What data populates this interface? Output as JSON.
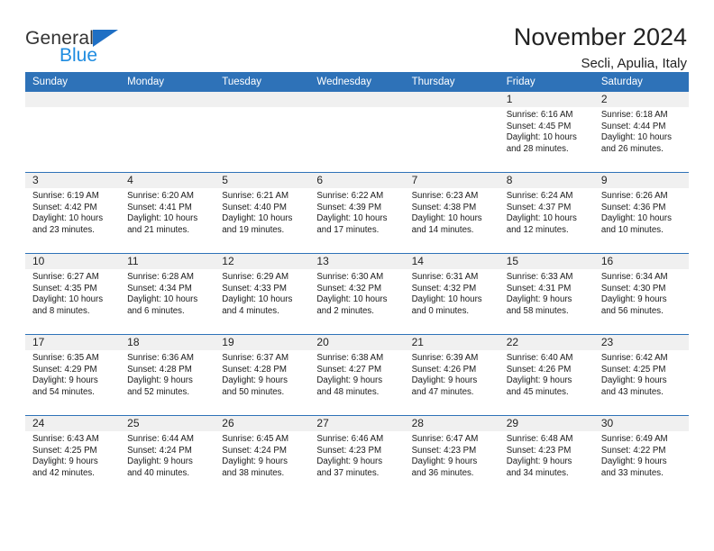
{
  "brand": {
    "name_line1": "General",
    "name_line2": "Blue",
    "triangle_color": "#1f6fc4",
    "blue_color": "#1f8ce0"
  },
  "header": {
    "title": "November 2024",
    "subtitle": "Secli, Apulia, Italy"
  },
  "theme": {
    "header_blue": "#2e72b8",
    "daynum_gray": "#f0f0f0"
  },
  "weekdays": [
    "Sunday",
    "Monday",
    "Tuesday",
    "Wednesday",
    "Thursday",
    "Friday",
    "Saturday"
  ],
  "labels": {
    "sunrise_prefix": "Sunrise:",
    "sunset_prefix": "Sunset:",
    "daylight_prefix": "Daylight:"
  },
  "weeks": [
    [
      {
        "day": "",
        "empty": true
      },
      {
        "day": "",
        "empty": true
      },
      {
        "day": "",
        "empty": true
      },
      {
        "day": "",
        "empty": true
      },
      {
        "day": "",
        "empty": true
      },
      {
        "day": "1",
        "sunrise": "Sunrise: 6:16 AM",
        "sunset": "Sunset: 4:45 PM",
        "daylight_line1": "Daylight: 10 hours",
        "daylight_line2": "and 28 minutes."
      },
      {
        "day": "2",
        "sunrise": "Sunrise: 6:18 AM",
        "sunset": "Sunset: 4:44 PM",
        "daylight_line1": "Daylight: 10 hours",
        "daylight_line2": "and 26 minutes."
      }
    ],
    [
      {
        "day": "3",
        "sunrise": "Sunrise: 6:19 AM",
        "sunset": "Sunset: 4:42 PM",
        "daylight_line1": "Daylight: 10 hours",
        "daylight_line2": "and 23 minutes."
      },
      {
        "day": "4",
        "sunrise": "Sunrise: 6:20 AM",
        "sunset": "Sunset: 4:41 PM",
        "daylight_line1": "Daylight: 10 hours",
        "daylight_line2": "and 21 minutes."
      },
      {
        "day": "5",
        "sunrise": "Sunrise: 6:21 AM",
        "sunset": "Sunset: 4:40 PM",
        "daylight_line1": "Daylight: 10 hours",
        "daylight_line2": "and 19 minutes."
      },
      {
        "day": "6",
        "sunrise": "Sunrise: 6:22 AM",
        "sunset": "Sunset: 4:39 PM",
        "daylight_line1": "Daylight: 10 hours",
        "daylight_line2": "and 17 minutes."
      },
      {
        "day": "7",
        "sunrise": "Sunrise: 6:23 AM",
        "sunset": "Sunset: 4:38 PM",
        "daylight_line1": "Daylight: 10 hours",
        "daylight_line2": "and 14 minutes."
      },
      {
        "day": "8",
        "sunrise": "Sunrise: 6:24 AM",
        "sunset": "Sunset: 4:37 PM",
        "daylight_line1": "Daylight: 10 hours",
        "daylight_line2": "and 12 minutes."
      },
      {
        "day": "9",
        "sunrise": "Sunrise: 6:26 AM",
        "sunset": "Sunset: 4:36 PM",
        "daylight_line1": "Daylight: 10 hours",
        "daylight_line2": "and 10 minutes."
      }
    ],
    [
      {
        "day": "10",
        "sunrise": "Sunrise: 6:27 AM",
        "sunset": "Sunset: 4:35 PM",
        "daylight_line1": "Daylight: 10 hours",
        "daylight_line2": "and 8 minutes."
      },
      {
        "day": "11",
        "sunrise": "Sunrise: 6:28 AM",
        "sunset": "Sunset: 4:34 PM",
        "daylight_line1": "Daylight: 10 hours",
        "daylight_line2": "and 6 minutes."
      },
      {
        "day": "12",
        "sunrise": "Sunrise: 6:29 AM",
        "sunset": "Sunset: 4:33 PM",
        "daylight_line1": "Daylight: 10 hours",
        "daylight_line2": "and 4 minutes."
      },
      {
        "day": "13",
        "sunrise": "Sunrise: 6:30 AM",
        "sunset": "Sunset: 4:32 PM",
        "daylight_line1": "Daylight: 10 hours",
        "daylight_line2": "and 2 minutes."
      },
      {
        "day": "14",
        "sunrise": "Sunrise: 6:31 AM",
        "sunset": "Sunset: 4:32 PM",
        "daylight_line1": "Daylight: 10 hours",
        "daylight_line2": "and 0 minutes."
      },
      {
        "day": "15",
        "sunrise": "Sunrise: 6:33 AM",
        "sunset": "Sunset: 4:31 PM",
        "daylight_line1": "Daylight: 9 hours",
        "daylight_line2": "and 58 minutes."
      },
      {
        "day": "16",
        "sunrise": "Sunrise: 6:34 AM",
        "sunset": "Sunset: 4:30 PM",
        "daylight_line1": "Daylight: 9 hours",
        "daylight_line2": "and 56 minutes."
      }
    ],
    [
      {
        "day": "17",
        "sunrise": "Sunrise: 6:35 AM",
        "sunset": "Sunset: 4:29 PM",
        "daylight_line1": "Daylight: 9 hours",
        "daylight_line2": "and 54 minutes."
      },
      {
        "day": "18",
        "sunrise": "Sunrise: 6:36 AM",
        "sunset": "Sunset: 4:28 PM",
        "daylight_line1": "Daylight: 9 hours",
        "daylight_line2": "and 52 minutes."
      },
      {
        "day": "19",
        "sunrise": "Sunrise: 6:37 AM",
        "sunset": "Sunset: 4:28 PM",
        "daylight_line1": "Daylight: 9 hours",
        "daylight_line2": "and 50 minutes."
      },
      {
        "day": "20",
        "sunrise": "Sunrise: 6:38 AM",
        "sunset": "Sunset: 4:27 PM",
        "daylight_line1": "Daylight: 9 hours",
        "daylight_line2": "and 48 minutes."
      },
      {
        "day": "21",
        "sunrise": "Sunrise: 6:39 AM",
        "sunset": "Sunset: 4:26 PM",
        "daylight_line1": "Daylight: 9 hours",
        "daylight_line2": "and 47 minutes."
      },
      {
        "day": "22",
        "sunrise": "Sunrise: 6:40 AM",
        "sunset": "Sunset: 4:26 PM",
        "daylight_line1": "Daylight: 9 hours",
        "daylight_line2": "and 45 minutes."
      },
      {
        "day": "23",
        "sunrise": "Sunrise: 6:42 AM",
        "sunset": "Sunset: 4:25 PM",
        "daylight_line1": "Daylight: 9 hours",
        "daylight_line2": "and 43 minutes."
      }
    ],
    [
      {
        "day": "24",
        "sunrise": "Sunrise: 6:43 AM",
        "sunset": "Sunset: 4:25 PM",
        "daylight_line1": "Daylight: 9 hours",
        "daylight_line2": "and 42 minutes."
      },
      {
        "day": "25",
        "sunrise": "Sunrise: 6:44 AM",
        "sunset": "Sunset: 4:24 PM",
        "daylight_line1": "Daylight: 9 hours",
        "daylight_line2": "and 40 minutes."
      },
      {
        "day": "26",
        "sunrise": "Sunrise: 6:45 AM",
        "sunset": "Sunset: 4:24 PM",
        "daylight_line1": "Daylight: 9 hours",
        "daylight_line2": "and 38 minutes."
      },
      {
        "day": "27",
        "sunrise": "Sunrise: 6:46 AM",
        "sunset": "Sunset: 4:23 PM",
        "daylight_line1": "Daylight: 9 hours",
        "daylight_line2": "and 37 minutes."
      },
      {
        "day": "28",
        "sunrise": "Sunrise: 6:47 AM",
        "sunset": "Sunset: 4:23 PM",
        "daylight_line1": "Daylight: 9 hours",
        "daylight_line2": "and 36 minutes."
      },
      {
        "day": "29",
        "sunrise": "Sunrise: 6:48 AM",
        "sunset": "Sunset: 4:23 PM",
        "daylight_line1": "Daylight: 9 hours",
        "daylight_line2": "and 34 minutes."
      },
      {
        "day": "30",
        "sunrise": "Sunrise: 6:49 AM",
        "sunset": "Sunset: 4:22 PM",
        "daylight_line1": "Daylight: 9 hours",
        "daylight_line2": "and 33 minutes."
      }
    ]
  ]
}
